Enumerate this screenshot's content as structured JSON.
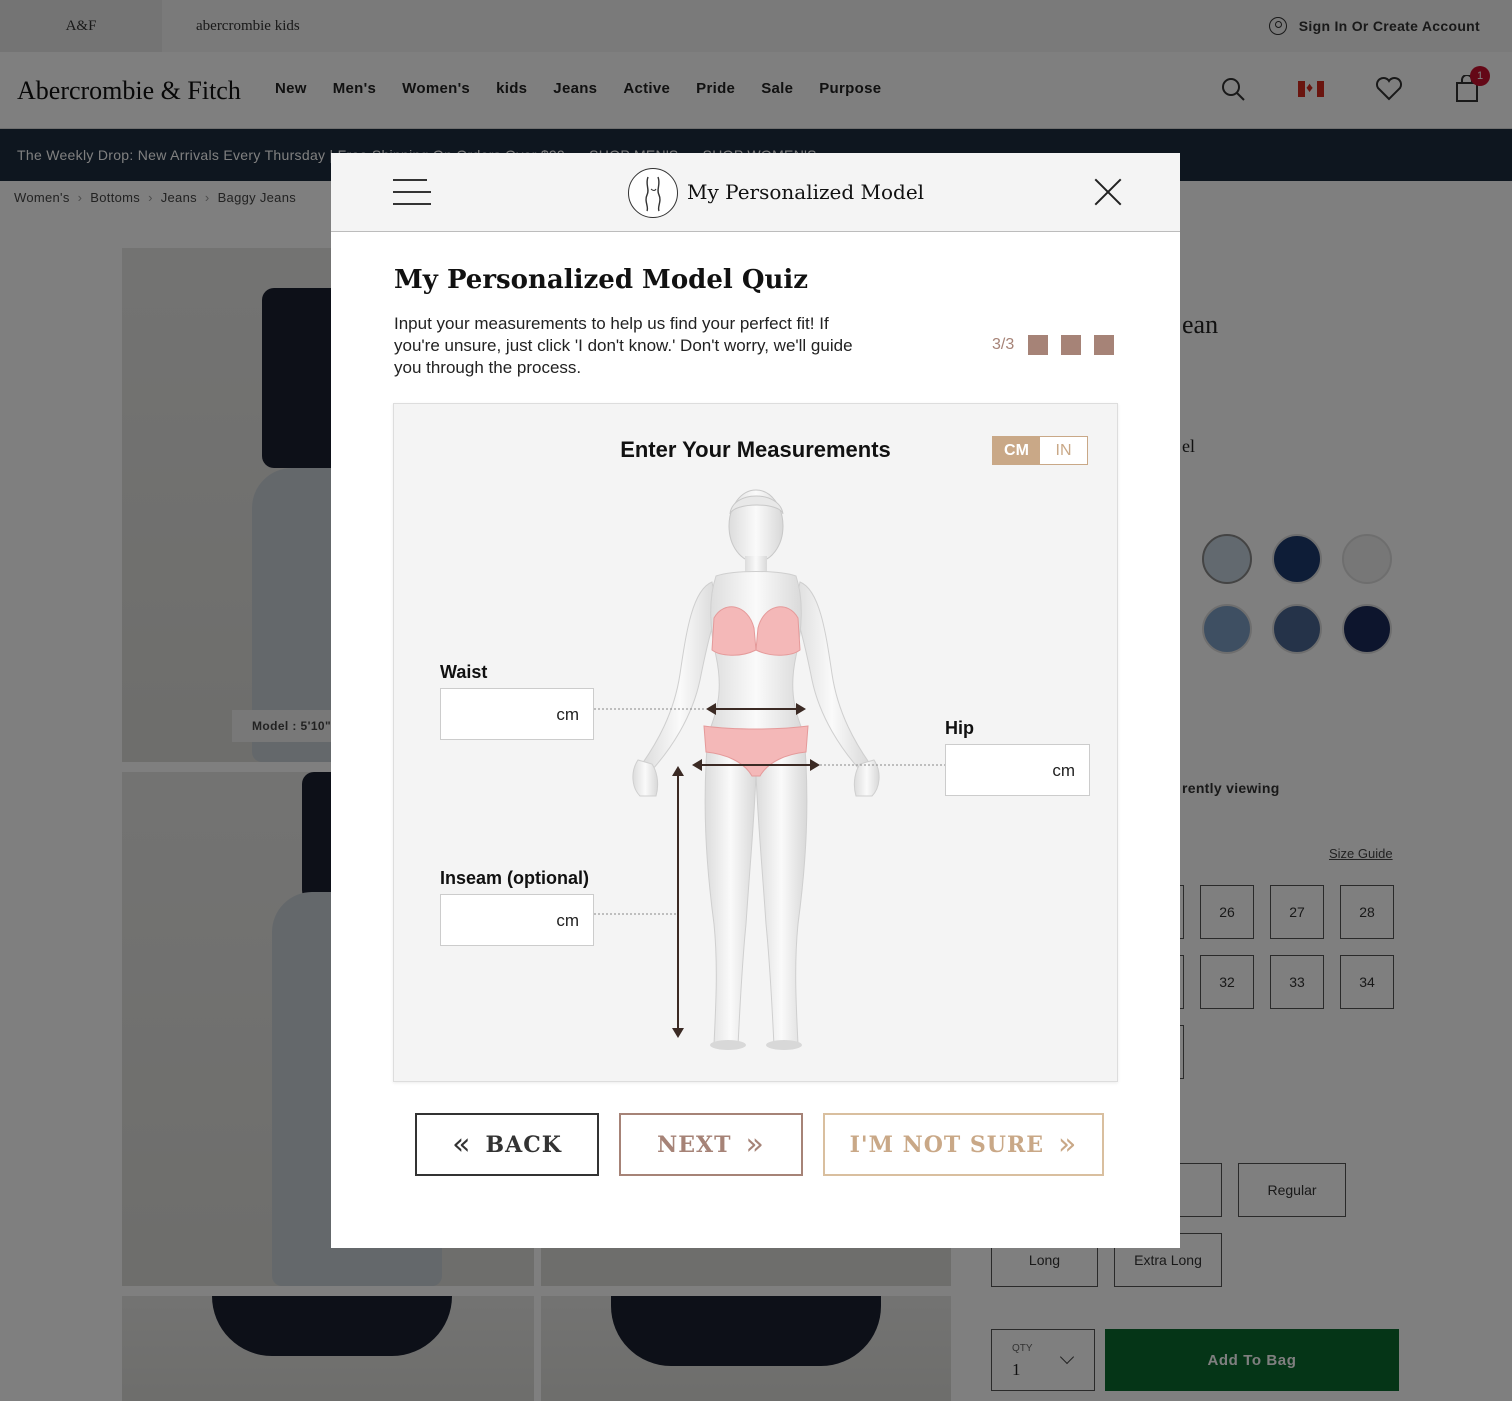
{
  "topbar": {
    "brand_af": "A&F",
    "brand_kids": "abercrombie kids",
    "signin": "Sign In Or Create Account"
  },
  "nav": {
    "logo": "Abercrombie & Fitch",
    "links": [
      "New",
      "Men's",
      "Women's",
      "kids",
      "Jeans",
      "Active",
      "Pride",
      "Sale",
      "Purpose"
    ],
    "icons": [
      "search-icon",
      "canada-flag-icon",
      "heart-icon",
      "bag-icon"
    ],
    "bag_count": "1"
  },
  "promo": {
    "text": "The Weekly Drop: New Arrivals Every Thursday | Free Shipping On Orders Over $99",
    "shop_mens": "SHOP MEN'S",
    "shop_womens": "SHOP WOMEN'S"
  },
  "breadcrumb": [
    "Women's",
    "Bottoms",
    "Jeans",
    "Baggy Jeans"
  ],
  "product": {
    "title_partial": "ean",
    "model_partial": "el",
    "model_tag": "Model : 5'10\"",
    "viewing_partial": "rently viewing",
    "size_guide": "Size Guide",
    "sizes_row1": [
      "26",
      "27",
      "28"
    ],
    "sizes_row2": [
      "32",
      "33",
      "34"
    ],
    "length_partial": "t",
    "lengths": [
      "Regular",
      "Long",
      "Extra Long"
    ],
    "qty_label": "QTY",
    "qty_value": "1",
    "add_to_bag": "Add To Bag"
  },
  "modal": {
    "header_title": "My Personalized Model",
    "quiz_title": "My Personalized Model Quiz",
    "description": "Input your measurements to help us find your perfect fit! If you're unsure, just click 'I don't know.' Don't worry, we'll guide you through the process.",
    "progress": "3/3",
    "panel_title": "Enter Your Measurements",
    "unit_cm": "CM",
    "unit_in": "IN",
    "fields": {
      "waist": {
        "label": "Waist",
        "value": "",
        "unit": "cm"
      },
      "hip": {
        "label": "Hip",
        "value": "",
        "unit": "cm"
      },
      "inseam": {
        "label": "Inseam (optional)",
        "value": "",
        "unit": "cm"
      }
    },
    "buttons": {
      "back": "BACK",
      "next": "NEXT",
      "not_sure": "I'M NOT SURE"
    },
    "colors": {
      "accent": "#a68377",
      "unit_active": "#c9a887"
    }
  }
}
